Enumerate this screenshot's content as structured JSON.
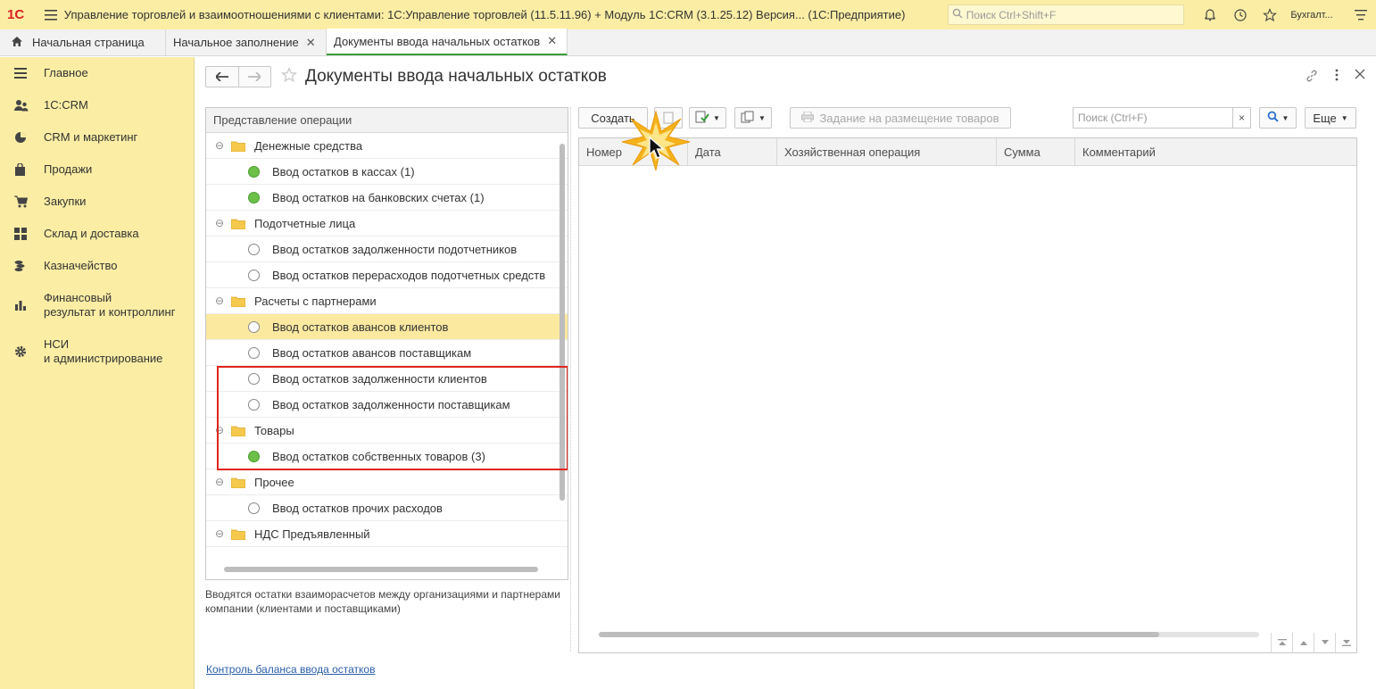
{
  "app": {
    "logo_text": "1С",
    "title": "Управление торговлей и взаимоотношениями с клиентами: 1С:Управление торговлей (11.5.11.96) + Модуль 1С:CRM (3.1.25.12) Версия...  (1С:Предприятие)",
    "search_placeholder": "Поиск Ctrl+Shift+F",
    "user": "Бухгалт..."
  },
  "tabs": [
    {
      "label": "Начальная страница",
      "active": false
    },
    {
      "label": "Начальное заполнение",
      "active": false
    },
    {
      "label": "Документы ввода начальных остатков",
      "active": true
    }
  ],
  "sidebar": {
    "items": [
      {
        "label": "Главное",
        "icon": "list-icon"
      },
      {
        "label": "1С:CRM",
        "icon": "users-icon"
      },
      {
        "label": "CRM и маркетинг",
        "icon": "pie-chart-icon"
      },
      {
        "label": "Продажи",
        "icon": "bag-icon"
      },
      {
        "label": "Закупки",
        "icon": "cart-icon"
      },
      {
        "label": "Склад и доставка",
        "icon": "grid-icon"
      },
      {
        "label": "Казначейство",
        "icon": "coins-icon"
      },
      {
        "label": "Финансовый\nрезультат и контроллинг",
        "line1": "Финансовый",
        "line2": "результат и контроллинг",
        "icon": "bar-chart-icon"
      },
      {
        "label": "НСИ\nи администрирование",
        "line1": "НСИ",
        "line2": "и администрирование",
        "icon": "gear-icon"
      }
    ]
  },
  "page": {
    "title": "Документы ввода начальных остатков"
  },
  "tree": {
    "header": "Представление операции",
    "groups": [
      {
        "label": "Денежные средства",
        "items": [
          {
            "label": "Ввод остатков в кассах (1)",
            "status": "green"
          },
          {
            "label": "Ввод остатков на банковских счетах (1)",
            "status": "green"
          }
        ]
      },
      {
        "label": "Подотчетные лица",
        "items": [
          {
            "label": "Ввод остатков задолженности подотчетников",
            "status": "empty"
          },
          {
            "label": "Ввод остатков перерасходов подотчетных средств",
            "status": "empty"
          }
        ]
      },
      {
        "label": "Расчеты с партнерами",
        "items": [
          {
            "label": "Ввод остатков авансов клиентов",
            "status": "empty",
            "selected": true
          },
          {
            "label": "Ввод остатков авансов поставщикам",
            "status": "empty"
          },
          {
            "label": "Ввод остатков задолженности клиентов",
            "status": "empty"
          },
          {
            "label": "Ввод остатков задолженности поставщикам",
            "status": "empty"
          }
        ]
      },
      {
        "label": "Товары",
        "items": [
          {
            "label": "Ввод остатков собственных товаров (3)",
            "status": "green"
          }
        ]
      },
      {
        "label": "Прочее",
        "items": [
          {
            "label": "Ввод остатков прочих расходов",
            "status": "empty"
          }
        ]
      },
      {
        "label": "НДС Предъявленный",
        "items": []
      }
    ]
  },
  "description": "Вводятся остатки взаиморасчетов между организациями и партнерами компании (клиентами и поставщиками)",
  "footer_link": "Контроль баланса ввода остатков",
  "toolbar": {
    "create": "Создать",
    "placement_task": "Задание на размещение товаров",
    "search_placeholder": "Поиск (Ctrl+F)",
    "clear": "×",
    "more": "Еще"
  },
  "grid": {
    "columns": [
      "Номер",
      "Дата",
      "Хозяйственная операция",
      "Сумма",
      "Комментарий"
    ],
    "rows": []
  },
  "colors": {
    "accent_yellow": "#fbeda4",
    "selected_row": "#fbe9a0",
    "highlight_frame": "#e0261d",
    "status_green": "#6cbf47",
    "link": "#2a5ea8"
  }
}
